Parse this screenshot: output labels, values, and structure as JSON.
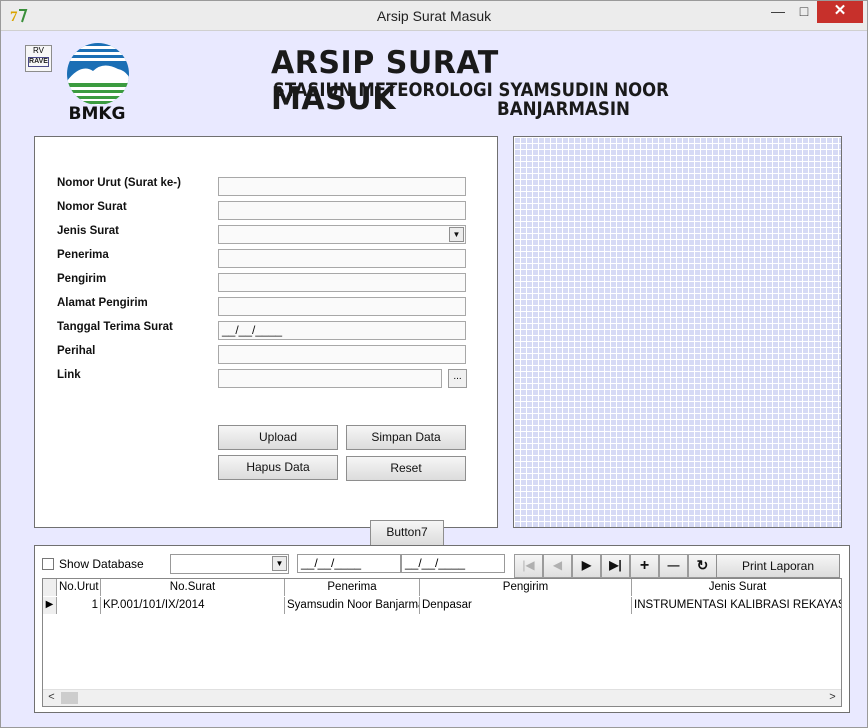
{
  "window": {
    "title": "Arsip Surat Masuk",
    "minimize_glyph": "—",
    "maximize_glyph": "□",
    "close_glyph": "✕"
  },
  "header": {
    "logo_text": "BMKG",
    "rave_top": "RV",
    "rave_box": "RAVE",
    "title": "ARSIP SURAT MASUK",
    "subtitle_line1": "STASIUN METEOROLOGI SYAMSUDIN NOOR",
    "subtitle_line2": "BANJARMASIN"
  },
  "form": {
    "nomor_urut_label": "Nomor Urut (Surat ke-)",
    "nomor_surat_label": "Nomor Surat",
    "jenis_surat_label": "Jenis Surat",
    "penerima_label": "Penerima",
    "pengirim_label": "Pengirim",
    "alamat_pengirim_label": "Alamat Pengirim",
    "tanggal_label": "Tanggal Terima Surat",
    "tanggal_value": "__/__/____",
    "perihal_label": "Perihal",
    "link_label": "Link",
    "browse_label": "...",
    "upload_label": "Upload",
    "simpan_label": "Simpan Data",
    "hapus_label": "Hapus Data",
    "reset_label": "Reset"
  },
  "button7_label": "Button7",
  "database": {
    "show_label": "Show Database",
    "date_from": "__/__/____",
    "date_to": "__/__/____",
    "nav_first": "|◀",
    "nav_prev": "◀",
    "nav_next": "▶",
    "nav_last": "▶|",
    "nav_add": "+",
    "nav_delete": "—",
    "nav_refresh": "↻",
    "print_label": "Print Laporan",
    "columns": [
      "No.Urut",
      "No.Surat",
      "Penerima",
      "Pengirim",
      "Jenis Surat"
    ],
    "rows": [
      {
        "indicator": "▶",
        "no_urut": "1",
        "no_surat": "KP.001/101/IX/2014",
        "penerima": "Syamsudin Noor Banjarmasin",
        "pengirim": "Denpasar",
        "jenis_surat": "INSTRUMENTASI KALIBRASI REKAYASA"
      }
    ],
    "scroll_left": "<",
    "scroll_right": ">"
  },
  "colors": {
    "window_bg": "#e9e9ff",
    "close_button": "#c7302b",
    "preview_grid": "#d6daf5",
    "logo_blue": "#1b6fb5",
    "logo_green": "#3b9b3f"
  }
}
